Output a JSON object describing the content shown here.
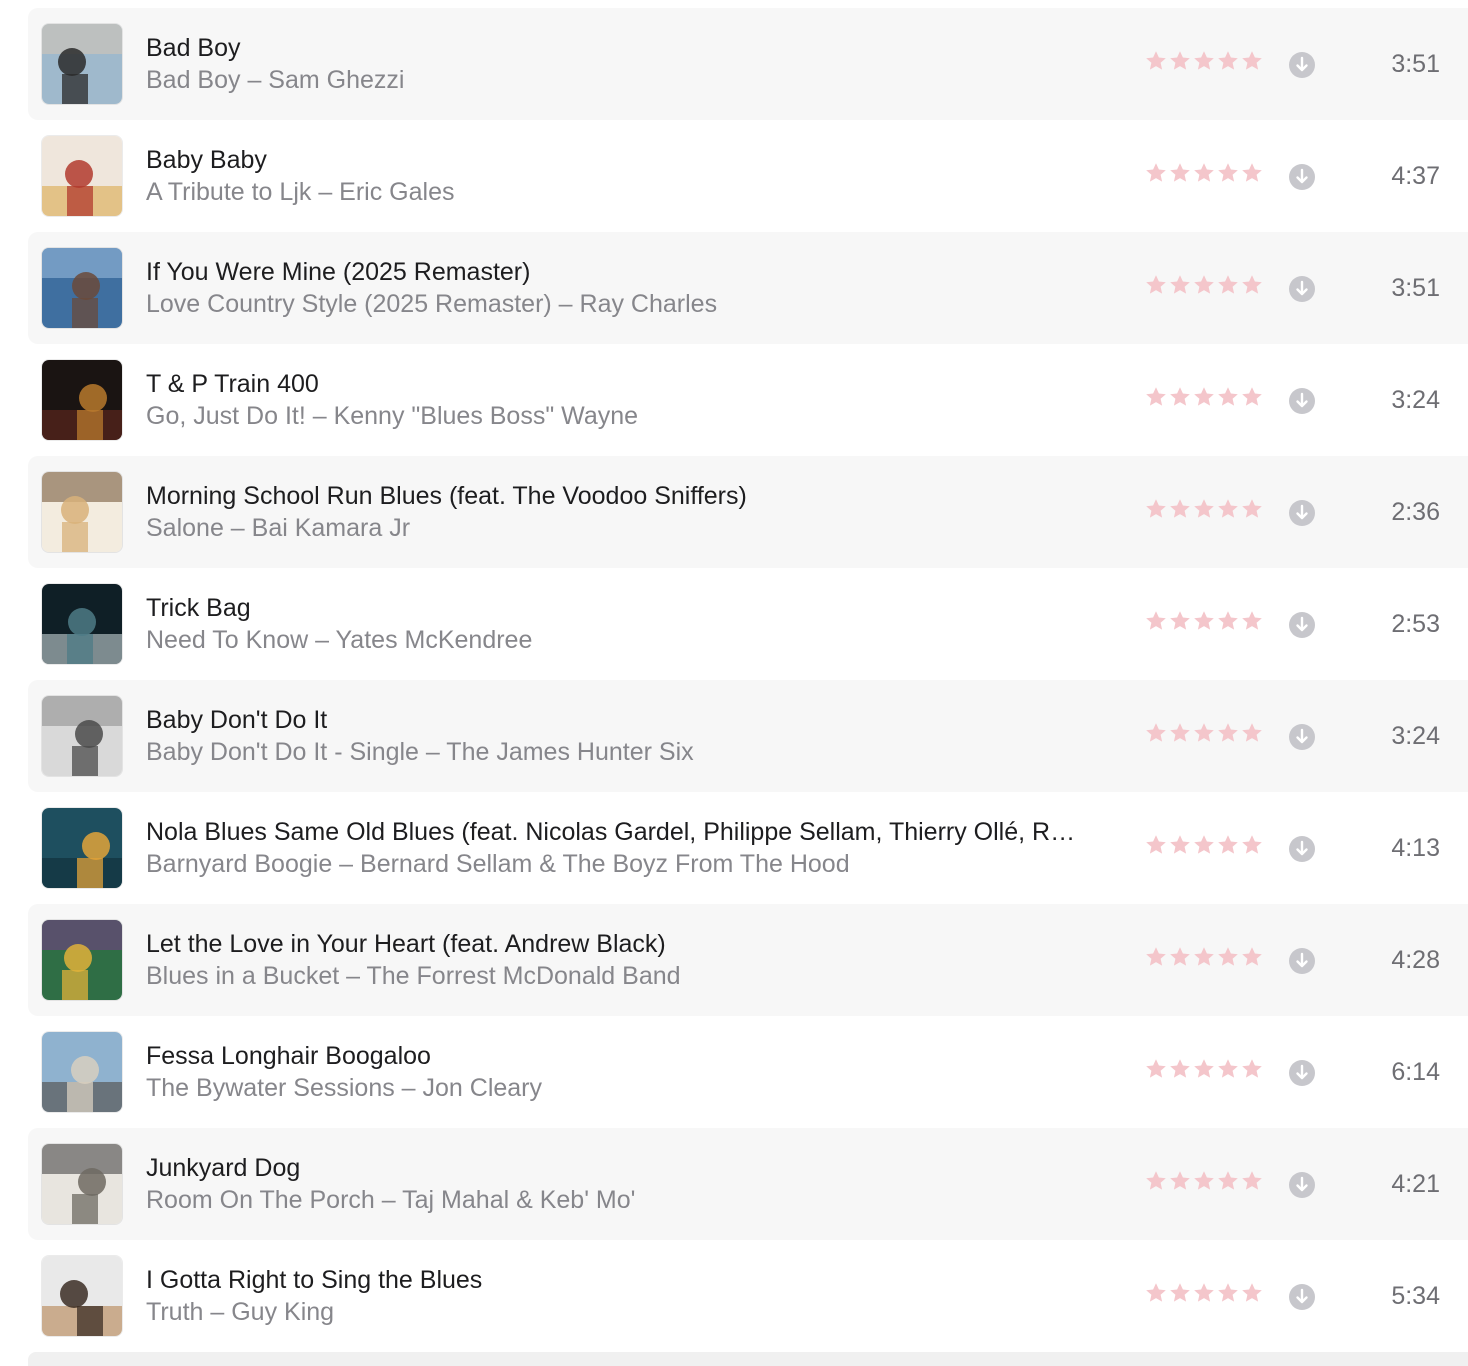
{
  "colors": {
    "row_alt_bg": "#f7f7f7",
    "title": "#1d1d1f",
    "subtitle": "#86868b",
    "star_empty": "#f4c6cb",
    "download_icon": "#c7c7cc"
  },
  "tracks": [
    {
      "title": "Bad Boy",
      "subtitle": "Bad Boy – Sam Ghezzi",
      "duration": "3:51",
      "rating": 0,
      "art": "sam-ghezzi-cover",
      "art_colors": [
        "#9fb9cc",
        "#2a2a2a",
        "#d6c7b5"
      ]
    },
    {
      "title": "Baby Baby",
      "subtitle": "A Tribute to Ljk – Eric Gales",
      "duration": "4:37",
      "rating": 0,
      "art": "tribute-ljk-cover",
      "art_colors": [
        "#efe6dc",
        "#b23a2e",
        "#d9a441"
      ]
    },
    {
      "title": "If You Were Mine (2025 Remaster)",
      "subtitle": "Love Country Style (2025 Remaster) – Ray Charles",
      "duration": "3:51",
      "rating": 0,
      "art": "ray-charles-cover",
      "art_colors": [
        "#3f6fa0",
        "#6b4a3a",
        "#9ec0e0"
      ]
    },
    {
      "title": "T & P Train 400",
      "subtitle": "Go, Just Do It! – Kenny \"Blues Boss\" Wayne",
      "duration": "3:24",
      "rating": 0,
      "art": "kenny-wayne-cover",
      "art_colors": [
        "#1a1412",
        "#b8792d",
        "#6e2a1f"
      ]
    },
    {
      "title": "Morning School Run Blues (feat. The Voodoo Sniffers)",
      "subtitle": "Salone – Bai Kamara Jr",
      "duration": "2:36",
      "rating": 0,
      "art": "salone-cover",
      "art_colors": [
        "#f3ecdf",
        "#d8b27a",
        "#6b4e2e"
      ]
    },
    {
      "title": "Trick Bag",
      "subtitle": "Need To Know – Yates McKendree",
      "duration": "2:53",
      "rating": 0,
      "art": "need-to-know-cover",
      "art_colors": [
        "#0f1f26",
        "#4d7b86",
        "#d8e3e6"
      ]
    },
    {
      "title": "Baby Don't Do It",
      "subtitle": "Baby Don't Do It - Single – The James Hunter Six",
      "duration": "3:24",
      "rating": 0,
      "art": "james-hunter-cover",
      "art_colors": [
        "#d9d9d9",
        "#4a4a4a",
        "#8a8a8a"
      ]
    },
    {
      "title": "Nola Blues Same Old Blues (feat. Nicolas Gardel, Philippe Sellam, Thierry Ollé, R…",
      "subtitle": "Barnyard Boogie – Bernard Sellam & The Boyz From The Hood",
      "duration": "4:13",
      "rating": 0,
      "art": "barnyard-boogie-cover",
      "art_colors": [
        "#1e4f5f",
        "#e2a33a",
        "#0f2a33"
      ]
    },
    {
      "title": "Let the Love in Your Heart (feat. Andrew Black)",
      "subtitle": "Blues in a Bucket – The Forrest McDonald Band",
      "duration": "4:28",
      "rating": 0,
      "art": "blues-in-bucket-cover",
      "art_colors": [
        "#2f6e45",
        "#e0b13a",
        "#7a3a8a"
      ]
    },
    {
      "title": "Fessa Longhair Boogaloo",
      "subtitle": "The Bywater Sessions – Jon Cleary",
      "duration": "6:14",
      "rating": 0,
      "art": "bywater-sessions-cover",
      "art_colors": [
        "#8fb2cf",
        "#d8cfc0",
        "#4a4036"
      ]
    },
    {
      "title": "Junkyard Dog",
      "subtitle": "Room On The Porch – Taj Mahal & Keb' Mo'",
      "duration": "4:21",
      "rating": 0,
      "art": "room-on-the-porch-cover",
      "art_colors": [
        "#e8e5df",
        "#6e6a62",
        "#3a3a3a"
      ]
    },
    {
      "title": "I Gotta Right to Sing the Blues",
      "subtitle": "Truth – Guy King",
      "duration": "5:34",
      "rating": 0,
      "art": "truth-guy-king-cover",
      "art_colors": [
        "#e9e9e9",
        "#3b2d24",
        "#b07a44"
      ]
    }
  ]
}
